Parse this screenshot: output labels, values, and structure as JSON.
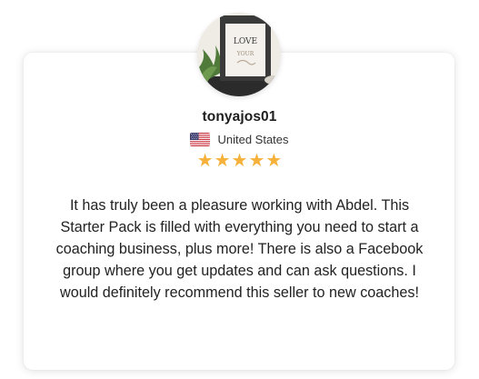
{
  "reviewer": {
    "username": "tonyajos01",
    "country": "United States",
    "flag_icon": "us-flag-icon",
    "avatar_sign_text": [
      "LOVE",
      "YOUR"
    ],
    "rating": 5,
    "rating_max": 5,
    "star_color": "#f5b13a"
  },
  "review": {
    "text": "It has truly been a pleasure working with Abdel. This Starter Pack is filled with everything you need to start a coaching business, plus more! There is also a Facebook group where you get updates and can ask questions. I would definitely recommend this seller to new coaches!"
  }
}
